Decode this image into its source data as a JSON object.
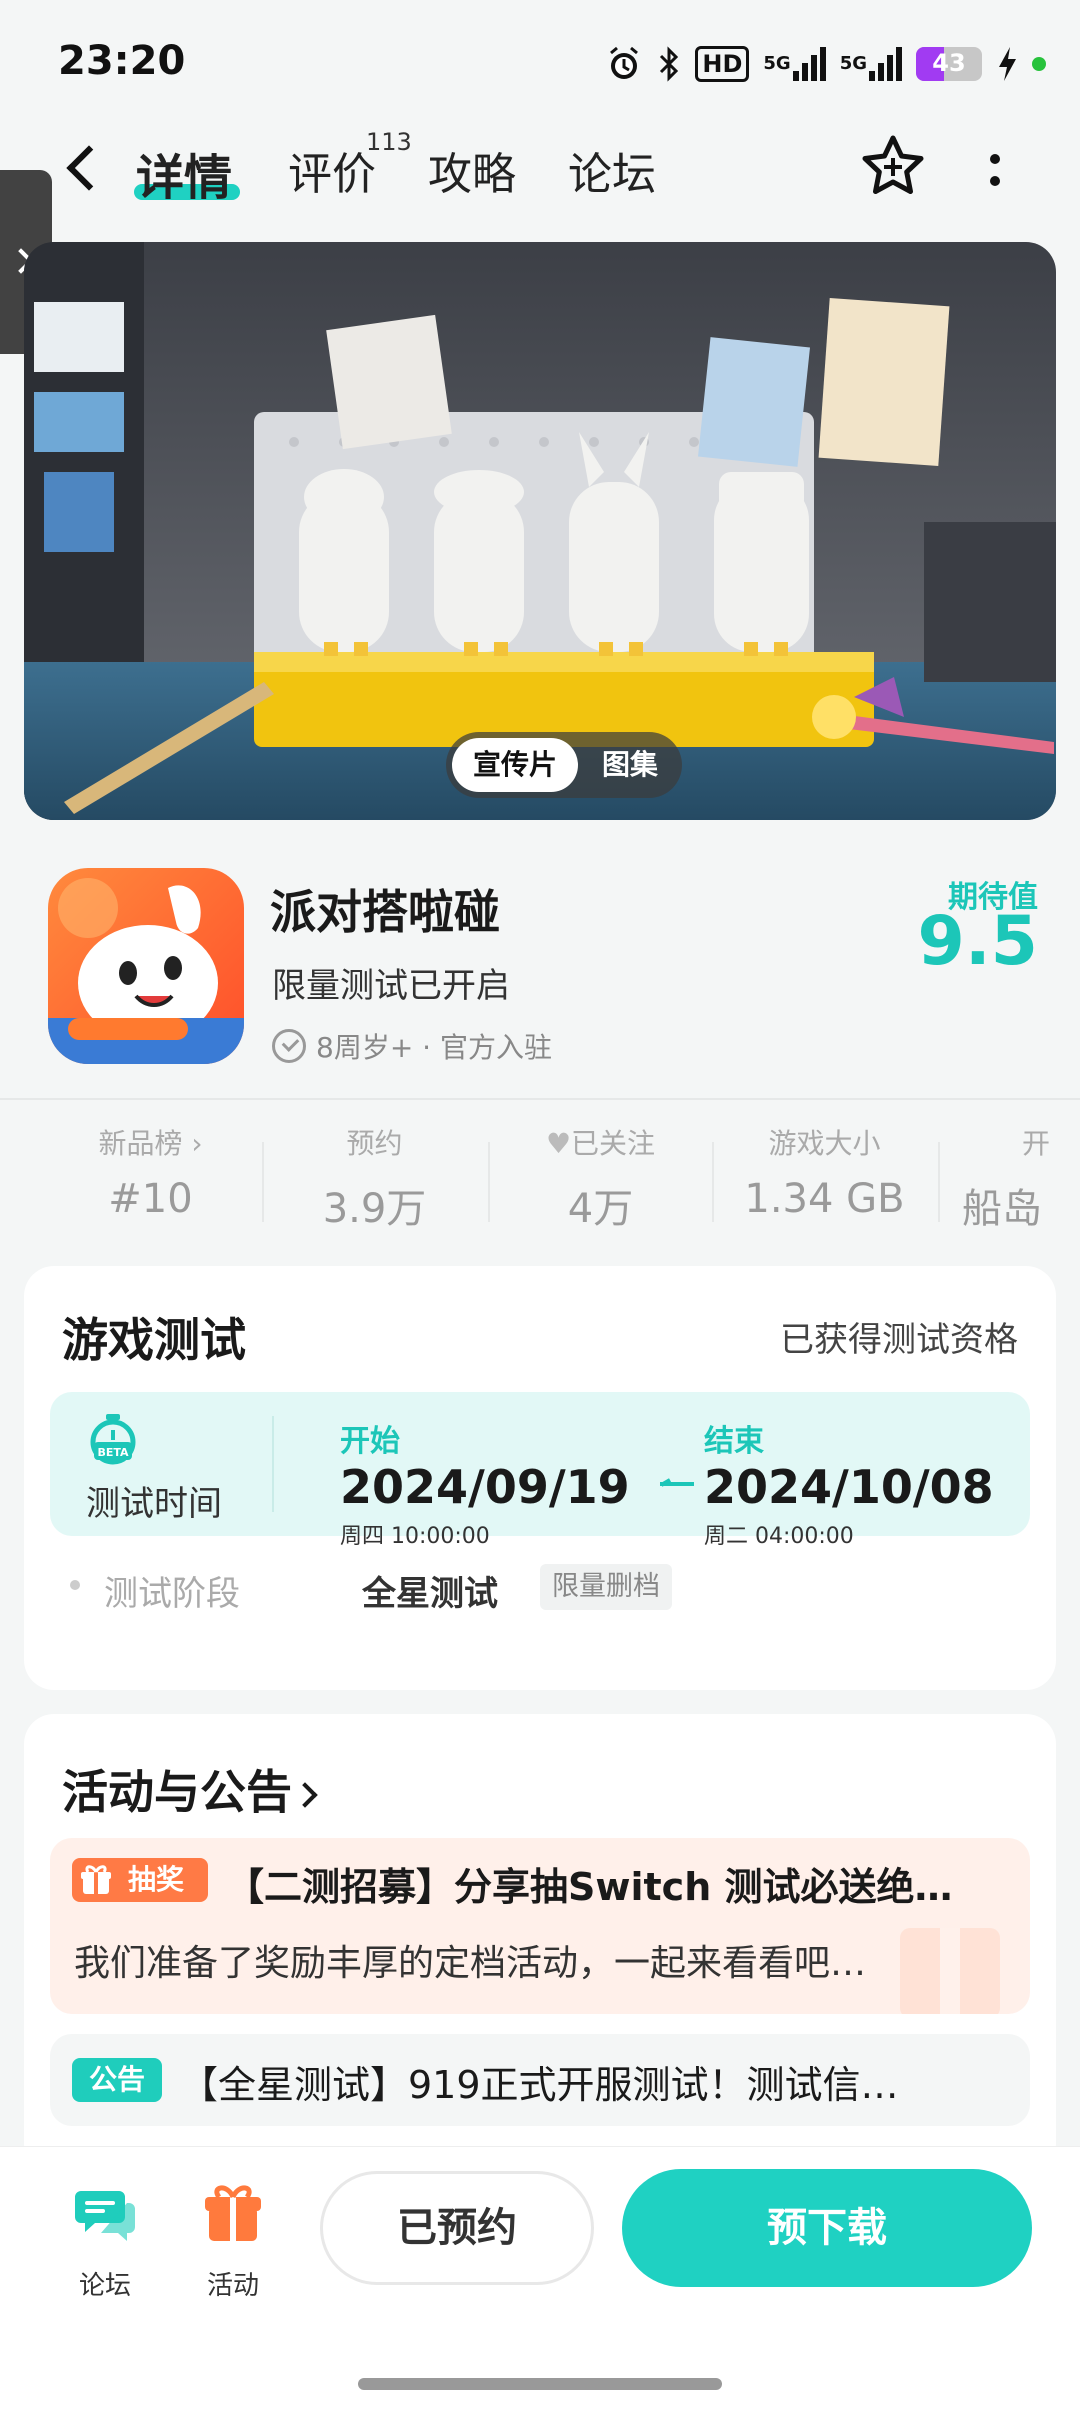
{
  "status_bar": {
    "time": "23:20",
    "hd_label": "HD",
    "net1": "5G",
    "net2": "5G",
    "battery": "43",
    "battery_level": 0.43,
    "battery_color": "#a13bf2"
  },
  "nav": {
    "tabs": [
      {
        "label": "详情",
        "active": true
      },
      {
        "label": "评价",
        "count": "113"
      },
      {
        "label": "攻略"
      },
      {
        "label": "论坛"
      }
    ],
    "icons": [
      "back-icon",
      "favorite-star-icon",
      "more-icon"
    ]
  },
  "hero": {
    "tab_video": "宣传片",
    "tab_gallery": "图集"
  },
  "app": {
    "name": "派对搭啦碰",
    "subtitle": "限量测试已开启",
    "meta": "8周岁+ · 官方入驻",
    "expect_label": "期待值",
    "expect_score": "9.5",
    "accent": "#1cc6b8"
  },
  "stats": [
    {
      "label": "新品榜",
      "value": "#10"
    },
    {
      "label": "预约",
      "value": "3.9万"
    },
    {
      "label": "已关注",
      "value": "4万"
    },
    {
      "label": "游戏大小",
      "value": "1.34 GB"
    },
    {
      "label": "开",
      "value": "船岛"
    }
  ],
  "game_test": {
    "title": "游戏测试",
    "status": "已获得测试资格",
    "time_label": "测试时间",
    "start_label": "开始",
    "start_date": "2024/09/19",
    "start_time": "周四  10:00:00",
    "end_label": "结束",
    "end_date": "2024/10/08",
    "end_time": "周二  04:00:00",
    "stage_label": "测试阶段",
    "stage_value": "全星测试",
    "stage_tag": "限量删档"
  },
  "events": {
    "title": "活动与公告",
    "items": [
      {
        "badge": "抽奖",
        "title": "【二测招募】分享抽Switch 测试必送绝…",
        "subtitle": "我们准备了奖励丰厚的定档活动，一起来看看吧…"
      },
      {
        "badge": "公告",
        "title": "【全星测试】919正式开服测试！测试信…"
      }
    ]
  },
  "bottom_bar": {
    "forum_label": "论坛",
    "activity_label": "活动",
    "reserved_label": "已预约",
    "download_label": "预下载"
  }
}
